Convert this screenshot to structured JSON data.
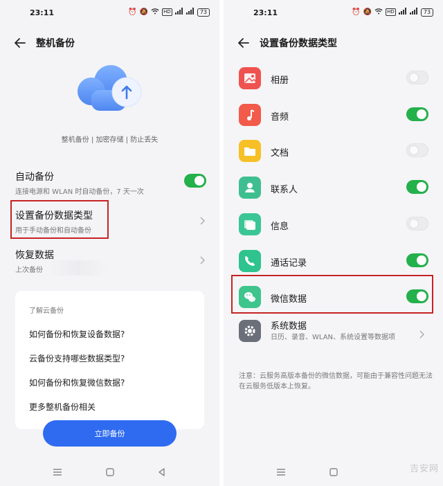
{
  "status": {
    "time": "23:11",
    "hd": "HD",
    "battery": "73"
  },
  "left": {
    "title": "整机备份",
    "tagline": "整机备份 | 加密存储 | 防止丢失",
    "auto_backup": {
      "label": "自动备份",
      "sub": "连接电源和 WLAN 时自动备份，7 天一次",
      "on": true
    },
    "set_types": {
      "label": "设置备份数据类型",
      "sub": "用于手动备份和自动备份"
    },
    "restore": {
      "label": "恢复数据",
      "sub": "上次备份"
    },
    "help": {
      "heading": "了解云备份",
      "items": [
        "如何备份和恢复设备数据?",
        "云备份支持哪些数据类型?",
        "如何备份和恢复微信数据?",
        "更多整机备份相关"
      ]
    },
    "button": "立即备份"
  },
  "right": {
    "title": "设置备份数据类型",
    "types": [
      {
        "label": "相册",
        "on": false,
        "color": "#ef5350"
      },
      {
        "label": "音频",
        "on": true,
        "color": "#f25a4a"
      },
      {
        "label": "文档",
        "on": false,
        "color": "#f6c026"
      },
      {
        "label": "联系人",
        "on": true,
        "color": "#3fbf8f"
      },
      {
        "label": "信息",
        "on": false,
        "color": "#3cc595"
      },
      {
        "label": "通话记录",
        "on": true,
        "color": "#2fc38e"
      },
      {
        "label": "微信数据",
        "on": true,
        "color": "#3dc58c"
      }
    ],
    "system": {
      "label": "系统数据",
      "sub": "日历、录音、WLAN、系统设置等数据项"
    },
    "note": "注意：云服务高版本备份的微信数据，可能由于兼容性问题无法在云服务低版本上恢复。"
  },
  "colors": {
    "accent": "#2f6bf0",
    "toggle_on": "#24b04b",
    "highlight": "#c62222"
  },
  "watermark": "吉安网"
}
